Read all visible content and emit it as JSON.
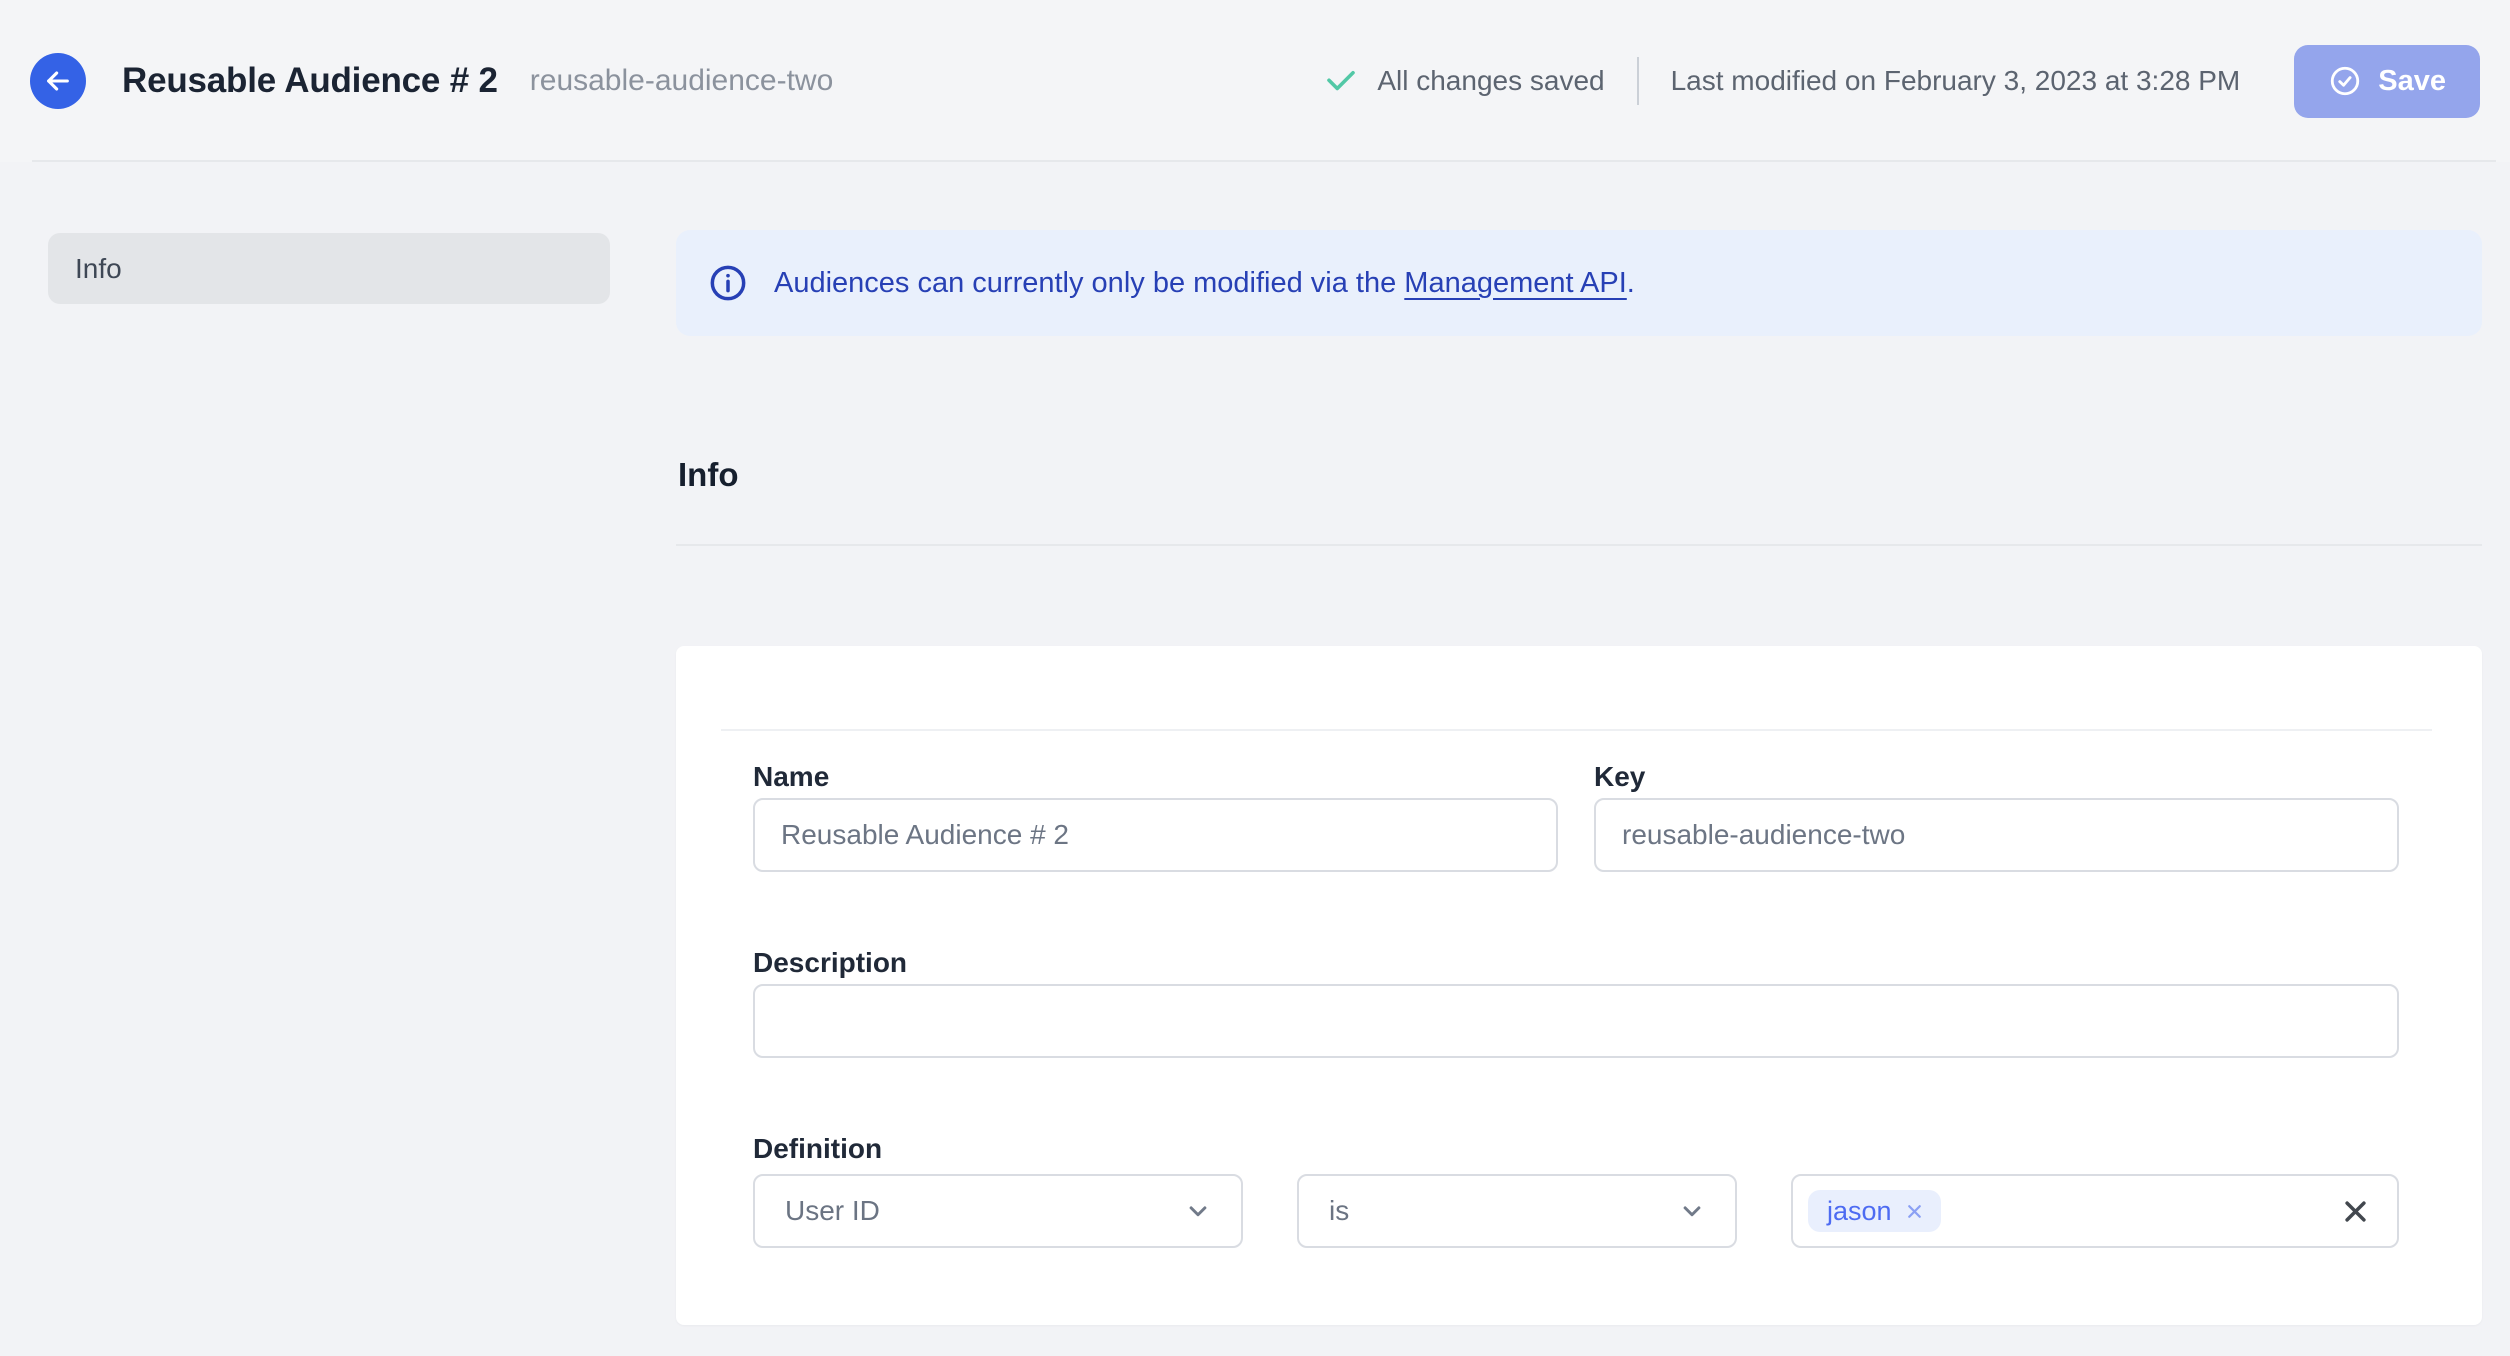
{
  "header": {
    "title": "Reusable Audience # 2",
    "subtitle": "reusable-audience-two",
    "status": "All changes saved",
    "last_modified": "Last modified on February 3, 2023 at 3:28 PM",
    "save_label": "Save"
  },
  "sidebar": {
    "items": [
      {
        "label": "Info"
      }
    ]
  },
  "banner": {
    "text": "Audiences can currently only be modified via the ",
    "link_text": "Management API",
    "suffix": "."
  },
  "section": {
    "heading": "Info"
  },
  "form": {
    "name": {
      "label": "Name",
      "value": "Reusable Audience # 2"
    },
    "key": {
      "label": "Key",
      "value": "reusable-audience-two"
    },
    "description": {
      "label": "Description",
      "value": ""
    },
    "definition": {
      "label": "Definition",
      "attribute": "User ID",
      "operator": "is",
      "values": [
        "jason"
      ]
    }
  },
  "icons": {
    "back": "arrow-left-icon",
    "saved": "check-icon",
    "save_button": "check-circle-icon",
    "banner": "info-circle-icon",
    "dropdown": "chevron-down-icon",
    "remove_tag": "x-icon",
    "clear_field": "x-icon"
  },
  "colors": {
    "page_bg": "#f2f3f6",
    "header_bg": "#f4f5f7",
    "accent_blue": "#3462e6",
    "save_bg": "#94a5ec",
    "success": "#52c8a6",
    "banner_bg": "#e9f0fc",
    "banner_fg": "#2740b5",
    "chip_bg": "#e9effd",
    "chip_fg": "#4d6bf2",
    "border": "#d9dce2",
    "text_dark": "#1b2433",
    "text_muted": "#5c6470",
    "label": "#202938",
    "input_text": "#6c7584"
  }
}
